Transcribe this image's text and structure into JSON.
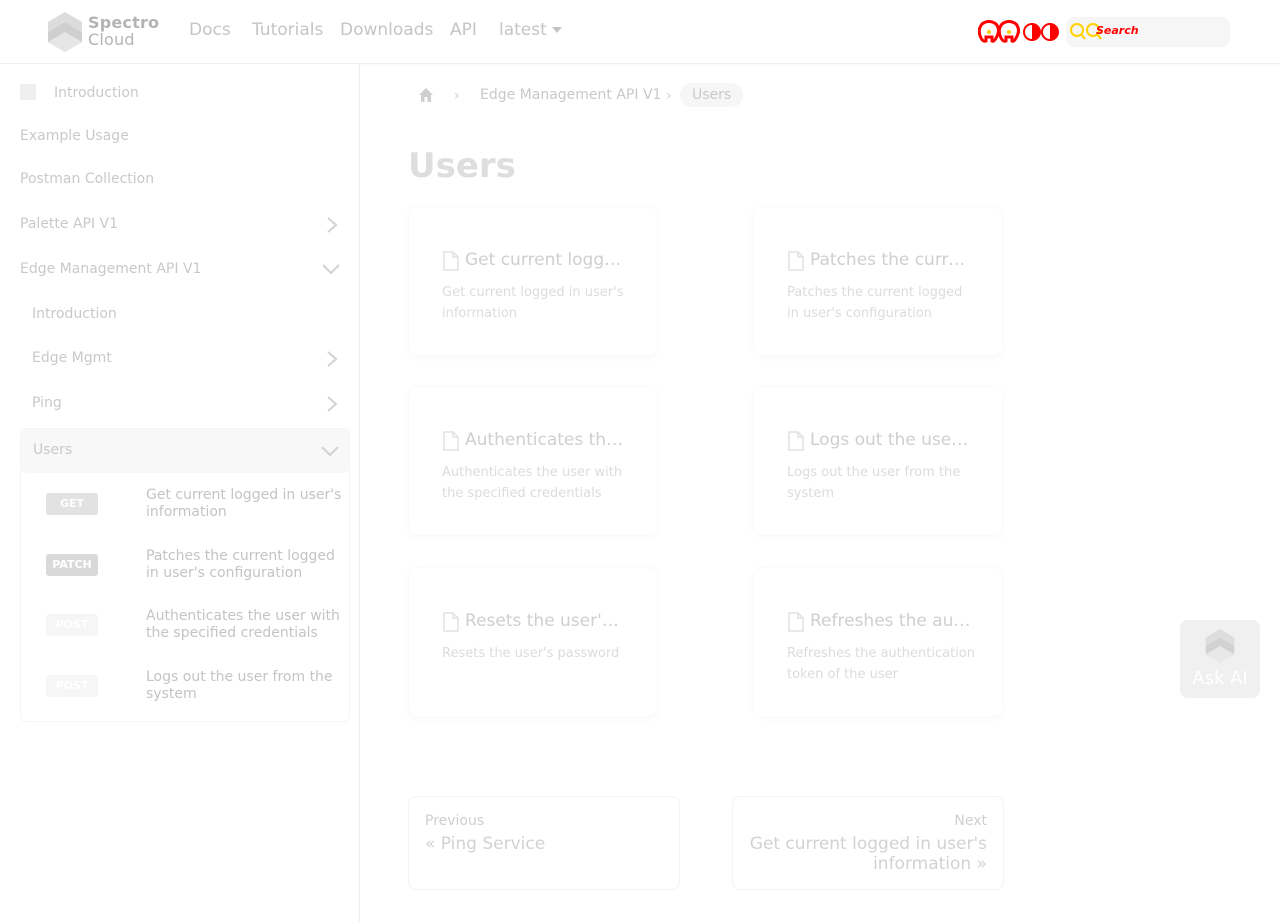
{
  "brand": {
    "logo_line1": "Spectro",
    "logo_line2": "Cloud"
  },
  "nav": {
    "links": [
      "Docs",
      "Tutorials",
      "Downloads",
      "API",
      "latest"
    ],
    "search_label": "Search"
  },
  "sidebar": {
    "top_items": [
      "Introduction",
      "Example Usage",
      "Postman Collection",
      "Palette API V1",
      "Edge Management API V1"
    ],
    "edge_children": [
      "Introduction",
      "Edge Mgmt",
      "Ping",
      "Users"
    ],
    "user_endpoints": [
      {
        "method": "GET",
        "label": "Get current logged in user's information",
        "color": "#e2e2e2"
      },
      {
        "method": "PATCH",
        "label": "Patches the current logged in user's configuration",
        "color": "#d9d9d9"
      },
      {
        "method": "POST",
        "label": "Authenticates the user with the specified credentials",
        "color": "#f6f6f6"
      },
      {
        "method": "POST",
        "label": "Logs out the user from the system",
        "color": "#f6f6f6"
      }
    ]
  },
  "breadcrumb": {
    "items": [
      "Edge Management API V1",
      "Users"
    ]
  },
  "page": {
    "title": "Users"
  },
  "cards": [
    {
      "title": "Get current logged…",
      "desc": "Get current logged in user's information"
    },
    {
      "title": "Patches the current…",
      "desc": "Patches the current logged in user's configuration"
    },
    {
      "title": "Authenticates the u…",
      "desc": "Authenticates the user with the specified credentials"
    },
    {
      "title": "Logs out the user fr…",
      "desc": "Logs out the user from the system"
    },
    {
      "title": "Resets the user's p…",
      "desc": "Resets the user's password"
    },
    {
      "title": "Refreshes the auth…",
      "desc": "Refreshes the authentication token of the user"
    }
  ],
  "pager": {
    "prev_sub": "Previous",
    "prev_label": "« Ping Service",
    "next_sub": "Next",
    "next_label": "Get current logged in user's information »"
  },
  "ask_ai": {
    "label": "Ask AI"
  },
  "colors": {
    "accent_red": "#ff0000",
    "accent_yellow": "#ffd200"
  }
}
